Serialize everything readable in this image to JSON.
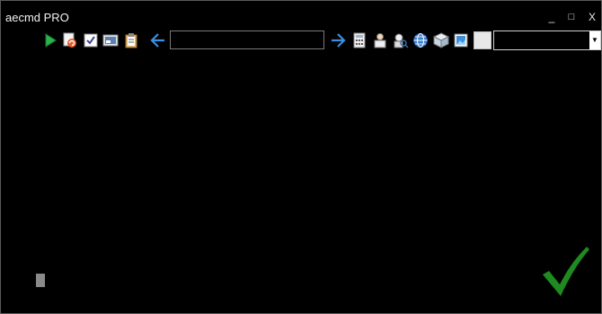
{
  "window": {
    "title": "aecmd PRO",
    "controls": {
      "minimize": "_",
      "maximize": "□",
      "close": "X"
    }
  },
  "toolbar": {
    "icons": [
      "run-icon",
      "refresh-icon",
      "checkbox-icon",
      "screen-icon",
      "clipboard-icon",
      "back-arrow-icon",
      "forward-arrow-icon",
      "calculator-icon",
      "user-icon",
      "search-user-icon",
      "globe-icon",
      "package-icon",
      "image-icon"
    ],
    "address_value": "",
    "combo_value": ""
  },
  "colors": {
    "background": "#000000",
    "title_text": "#f2f2f2",
    "check_green": "#1f8a1f",
    "arrow_blue": "#3b8ee0"
  }
}
